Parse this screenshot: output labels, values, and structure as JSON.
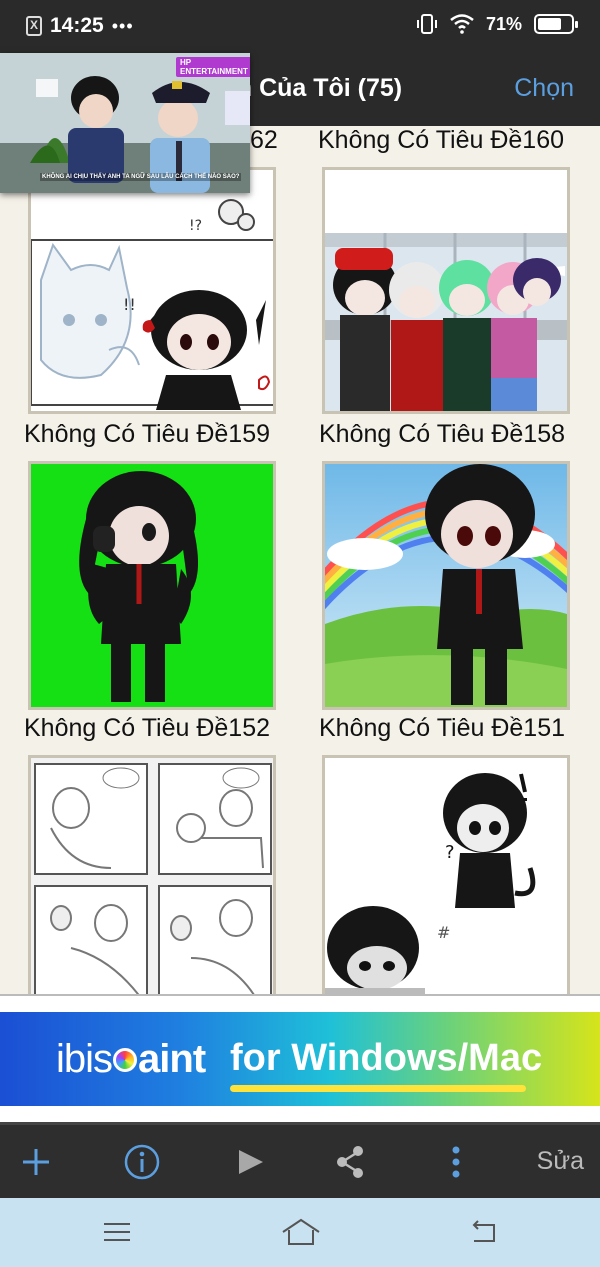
{
  "status_bar": {
    "time": "14:25",
    "overflow_dots": "•••",
    "notification_icon": "X",
    "battery_percent": "71%",
    "battery_level": 0.71,
    "icons": [
      "vibrate-icon",
      "wifi-icon",
      "battery-icon"
    ]
  },
  "header": {
    "title": "iện Của Tôi (75)",
    "select_label": "Chọn"
  },
  "gallery": {
    "top_partial_labels": [
      "62",
      "Không Có Tiêu Đề160"
    ],
    "items": [
      {
        "label": "Không Có Tiêu Đề159"
      },
      {
        "label": "Không Có Tiêu Đề158"
      },
      {
        "label": "Không Có Tiêu Đề152"
      },
      {
        "label": "Không Có Tiêu Đề151"
      },
      {
        "label": ""
      },
      {
        "label": ""
      }
    ]
  },
  "video_overlay": {
    "brand": "HP ENTERTAINMENT",
    "subtitle": "KHÔNG AI CHỊU THẤY ANH TA NGỮ SAU LÂU CÁCH THẾ NÀO SAO?"
  },
  "ad": {
    "logo_left": "ibis",
    "logo_right": "aint",
    "tagline": "for Windows/Mac"
  },
  "toolbar": {
    "edit_label": "Sửa",
    "icons": [
      "add-icon",
      "info-icon",
      "play-icon",
      "share-icon",
      "more-vert-icon"
    ]
  },
  "colors": {
    "accent": "#5c9fe0",
    "bar_dark": "#2a2a2a",
    "gallery_bg": "#f4f1e8",
    "nav_bg": "#c8e2f1"
  }
}
